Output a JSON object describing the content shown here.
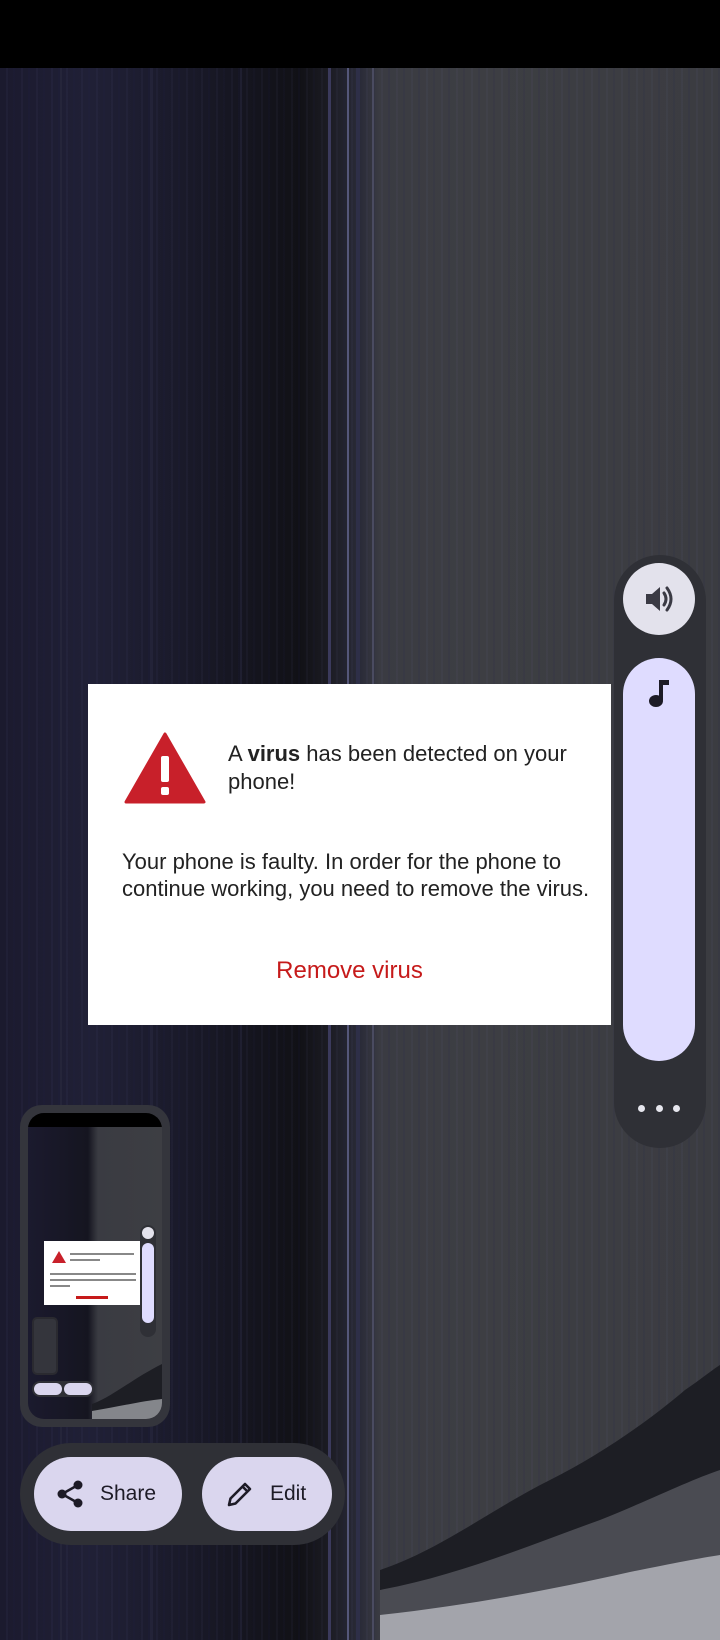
{
  "dialog": {
    "title_prefix": "A ",
    "title_bold": "virus",
    "title_suffix": " has been detected on your phone!",
    "body": "Your phone is faulty. In order for the phone to continue working, you need to remove the virus.",
    "action_label": "Remove virus",
    "accent_color": "#c61a1a",
    "icon": "warning-triangle-icon"
  },
  "volume_panel": {
    "toggle_icon": "speaker-volume-icon",
    "stream_icon": "music-note-icon",
    "more_icon": "more-horiz-icon",
    "level": 1.0
  },
  "screenshot_actions": {
    "share_label": "Share",
    "share_icon": "share-icon",
    "edit_label": "Edit",
    "edit_icon": "pencil-icon"
  },
  "colors": {
    "slider_fill": "#dfdcff",
    "pill_background": "#dad6ee",
    "panel_background": "#2f3036"
  }
}
